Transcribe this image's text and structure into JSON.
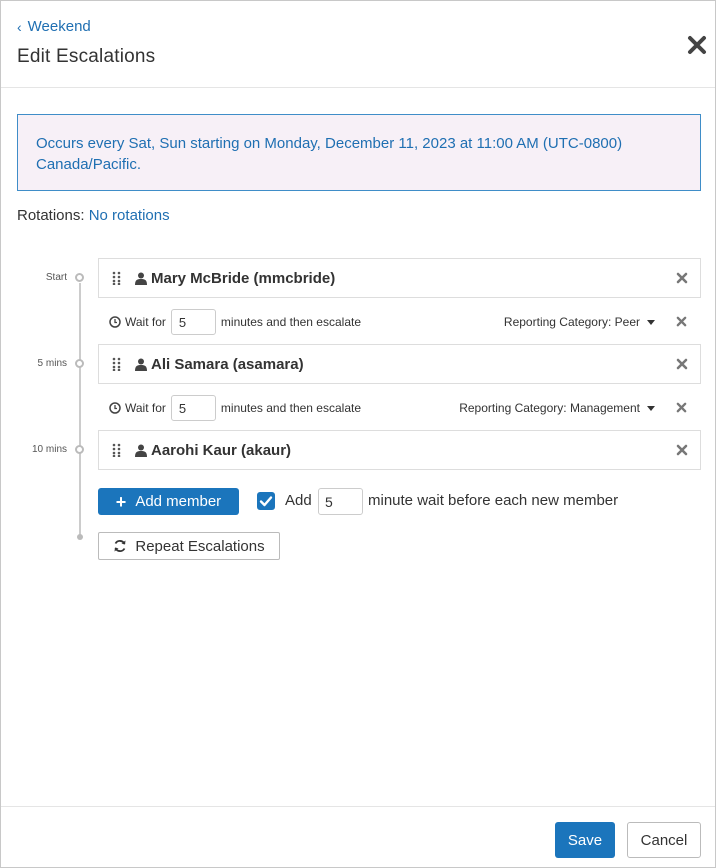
{
  "header": {
    "back_label": "Weekend",
    "title": "Edit Escalations"
  },
  "schedule_info": "Occurs every Sat, Sun starting on Monday, December 11, 2023 at 11:00 AM (UTC-0800) Canada/Pacific.",
  "rotations": {
    "label": "Rotations:",
    "value": "No rotations"
  },
  "timeline_labels": [
    "Start",
    "5 mins",
    "10 mins"
  ],
  "members": [
    {
      "name": "Mary McBride (mmcbride)"
    },
    {
      "name": "Ali Samara (asamara)"
    },
    {
      "name": "Aarohi Kaur (akaur)"
    }
  ],
  "waits": [
    {
      "prefix": "Wait for",
      "value": "5",
      "suffix": "minutes and then escalate",
      "category": "Reporting Category: Peer"
    },
    {
      "prefix": "Wait for",
      "value": "5",
      "suffix": "minutes and then escalate",
      "category": "Reporting Category: Management"
    }
  ],
  "add_member": {
    "button_label": "Add member",
    "checkbox_checked": true,
    "add_label": "Add",
    "wait_value": "5",
    "suffix": "minute wait before each new member"
  },
  "repeat_label": "Repeat Escalations",
  "footer": {
    "save_label": "Save",
    "cancel_label": "Cancel"
  },
  "colors": {
    "accent": "#1b75bc",
    "link": "#1f6fb2",
    "info_bg": "#f7f0f7"
  },
  "icons": {
    "back": "chevron-left-icon",
    "close": "close-icon",
    "drag": "drag-handle-icon",
    "user": "user-icon",
    "remove": "remove-icon",
    "clock": "clock-icon",
    "plus": "plus-icon",
    "check": "check-icon",
    "refresh": "refresh-icon"
  }
}
